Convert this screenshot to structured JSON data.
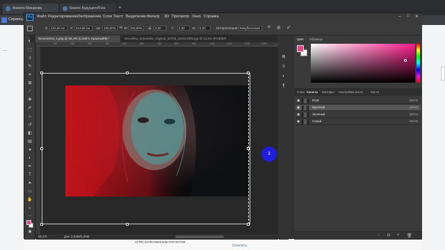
{
  "browser": {
    "tabs": [
      {
        "label": "Анжела Макарова"
      },
      {
        "label": "Бизнес Будущего/Futu"
      },
      {
        "label": "Сервисы"
      }
    ],
    "add_tab": "+"
  },
  "page": {
    "bottom_text_1": "сетях качественным контентом",
    "bottom_text_2": "Ответить"
  },
  "photoshop": {
    "logo": "Ps",
    "menu": [
      "Файл",
      "Редактирование",
      "Изображение",
      "Слои",
      "Текст",
      "Выделение",
      "Фильтр",
      "3D",
      "Просмотр",
      "Окно",
      "Справка"
    ],
    "options": {
      "x_value": "422,50 пи",
      "y_value": "213,50 пи",
      "w_value": "100,00%",
      "h_value": "100,00%",
      "angle_value": "0,00",
      "h_skew": "0,00",
      "v_skew": "0,00",
      "interp_label": "Интерполяция:",
      "interp_value": "Бикубическая"
    },
    "doc_tabs": [
      {
        "label": "Screenshot_1.png @ 55,1% (Слой 0, Красный/8) *"
      },
      {
        "label": "devushka_bryunetka_vzglyad_83709_1920x1080.jpg @ 33,3% (RGB/8#)"
      }
    ],
    "ruler_ticks": [
      "100",
      "200",
      "300",
      "400",
      "500",
      "600",
      "700",
      "800",
      "900",
      "1000",
      "1100",
      "1200",
      "1300"
    ],
    "status": {
      "zoom": "55,1%",
      "doc": "Док: 2,54M/5,28M"
    },
    "color_panel": {
      "tabs": [
        "Цвет",
        "Образцы"
      ],
      "foreground": "#e04a8a",
      "background": "#ffffff"
    },
    "channels_panel": {
      "tabs": [
        "Слои",
        "Каналы",
        "Контуры",
        "Настройки кисти",
        "Кисти"
      ],
      "channels": [
        {
          "name": "RGB",
          "shortcut": "Ctrl+2"
        },
        {
          "name": "Красный",
          "shortcut": "Ctrl+3"
        },
        {
          "name": "Зеленый",
          "shortcut": "Ctrl+4"
        },
        {
          "name": "Синий",
          "shortcut": "Ctrl+5"
        }
      ]
    },
    "cursor_marker": "3"
  }
}
